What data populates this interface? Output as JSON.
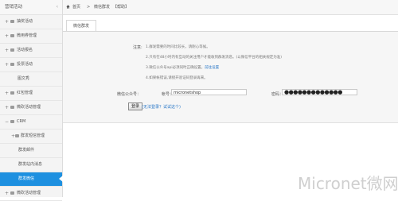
{
  "sidebar": {
    "title": "营销活动",
    "items": [
      {
        "label": "抽奖活动",
        "expand": "+"
      },
      {
        "label": "微用券管理",
        "expand": "+"
      },
      {
        "label": "活动报名",
        "expand": "+"
      },
      {
        "label": "投票活动",
        "expand": "+"
      },
      {
        "label": "图文秀"
      },
      {
        "label": "红包管理",
        "expand": "+"
      },
      {
        "label": "微砍活动管理",
        "expand": "+"
      },
      {
        "label": "CRM",
        "expand": "−"
      },
      {
        "label": "群发短信管理",
        "expand": "+"
      },
      {
        "label": "群发邮件"
      },
      {
        "label": "群发站内消息"
      },
      {
        "label": "群发微信"
      },
      {
        "label": "微砍活动管理",
        "expand": "+"
      }
    ]
  },
  "breadcrumb": {
    "home": "首页",
    "sep1": ">",
    "page": "微信群发",
    "help": "【帮助】"
  },
  "tabs": [
    {
      "label": "微信群发"
    }
  ],
  "notes": {
    "label": "注意:",
    "line1": "1.群发需要的时间比较长，请耐心等候。",
    "line2": "2.只有在48小时内有互动的关注用户才能收到群发消息。(以微信平台的相关规定为准)",
    "line3_prefix": "3.微信公众号api必须同时正确设置。",
    "line3_link": "前往设置",
    "line4": "4.如果帐错误,请接开验证码登录再来。"
  },
  "form": {
    "wechat_label": "微信公众号：",
    "account_label": "帐号：",
    "account_value": "micronetshop",
    "password_label": "密码：",
    "password_value": "●●●●●●●●●●●●●",
    "login_button": "登录",
    "register_link": "(无法登录？试试这个)"
  },
  "watermark": "Micronet微网"
}
